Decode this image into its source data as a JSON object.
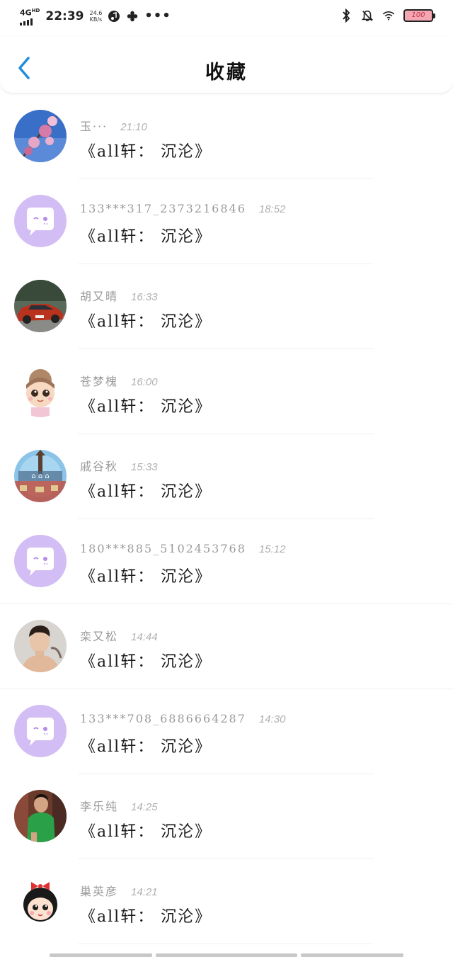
{
  "status_bar": {
    "network": "4G",
    "network_sup": "HD",
    "time": "22:39",
    "speed_value": "24.6",
    "speed_unit": "KB/s",
    "battery": "100"
  },
  "header": {
    "title": "收藏"
  },
  "items": [
    {
      "name": "玉···",
      "time": "21:10",
      "content": "《all轩： 沉沦》",
      "avatar": "flower-avatar"
    },
    {
      "name": "133***317_2373216846",
      "time": "18:52",
      "content": "《all轩： 沉沦》",
      "avatar": "default-chat-avatar"
    },
    {
      "name": "胡又晴",
      "time": "16:33",
      "content": "《all轩： 沉沦》",
      "avatar": "car-avatar"
    },
    {
      "name": "苍梦槐",
      "time": "16:00",
      "content": "《all轩： 沉沦》",
      "avatar": "cartoon-girl-avatar"
    },
    {
      "name": "戚谷秋",
      "time": "15:33",
      "content": "《all轩： 沉沦》",
      "avatar": "city-avatar"
    },
    {
      "name": "180***885_5102453768",
      "time": "15:12",
      "content": "《all轩： 沉沦》",
      "avatar": "default-chat-avatar"
    },
    {
      "name": "栾又松",
      "time": "14:44",
      "content": "《all轩： 沉沦》",
      "avatar": "man-avatar"
    },
    {
      "name": "133***708_6886664287",
      "time": "14:30",
      "content": "《all轩： 沉沦》",
      "avatar": "default-chat-avatar"
    },
    {
      "name": "李乐纯",
      "time": "14:25",
      "content": "《all轩： 沉沦》",
      "avatar": "person-green-avatar"
    },
    {
      "name": "巢英彦",
      "time": "14:21",
      "content": "《all轩： 沉沦》",
      "avatar": "cartoon-bow-avatar"
    }
  ]
}
